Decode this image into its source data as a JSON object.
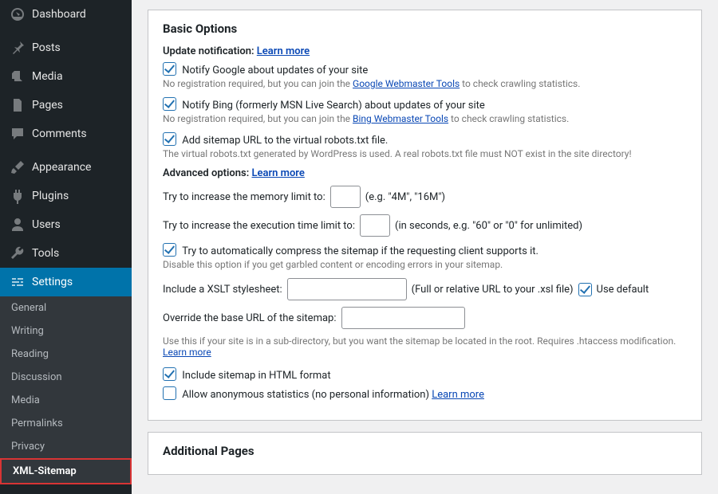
{
  "sidebar": {
    "items": [
      {
        "label": "Dashboard",
        "icon": "dashboard"
      },
      {
        "label": "Posts",
        "icon": "pin"
      },
      {
        "label": "Media",
        "icon": "media"
      },
      {
        "label": "Pages",
        "icon": "page"
      },
      {
        "label": "Comments",
        "icon": "comment"
      },
      {
        "label": "Appearance",
        "icon": "brush"
      },
      {
        "label": "Plugins",
        "icon": "plug"
      },
      {
        "label": "Users",
        "icon": "user"
      },
      {
        "label": "Tools",
        "icon": "wrench"
      },
      {
        "label": "Settings",
        "icon": "sliders",
        "current": true
      }
    ],
    "submenu": [
      {
        "label": "General"
      },
      {
        "label": "Writing"
      },
      {
        "label": "Reading"
      },
      {
        "label": "Discussion"
      },
      {
        "label": "Media"
      },
      {
        "label": "Permalinks"
      },
      {
        "label": "Privacy"
      },
      {
        "label": "XML-Sitemap",
        "active": true
      }
    ]
  },
  "panel": {
    "heading": "Basic Options",
    "update": {
      "label": "Update notification:",
      "learn_more": "Learn more",
      "google_label": "Notify Google about updates of your site",
      "google_help_pre": "No registration required, but you can join the ",
      "google_help_link": "Google Webmaster Tools",
      "google_help_post": " to check crawling statistics.",
      "bing_label": "Notify Bing (formerly MSN Live Search) about updates of your site",
      "bing_help_pre": "No registration required, but you can join the ",
      "bing_help_link": "Bing Webmaster Tools",
      "bing_help_post": " to check crawling statistics.",
      "robots_label": "Add sitemap URL to the virtual robots.txt file.",
      "robots_help": "The virtual robots.txt generated by WordPress is used. A real robots.txt file must NOT exist in the site directory!"
    },
    "advanced": {
      "label": "Advanced options:",
      "learn_more": "Learn more",
      "memory_pre": "Try to increase the memory limit to:",
      "memory_hint": "(e.g. \"4M\", \"16M\")",
      "time_pre": "Try to increase the execution time limit to:",
      "time_hint": "(in seconds, e.g. \"60\" or \"0\" for unlimited)",
      "compress_label": "Try to automatically compress the sitemap if the requesting client supports it.",
      "compress_help": "Disable this option if you get garbled content or encoding errors in your sitemap.",
      "xslt_pre": "Include a XSLT stylesheet:",
      "xslt_hint": "(Full or relative URL to your .xsl file)",
      "xslt_default_label": "Use default",
      "baseurl_pre": "Override the base URL of the sitemap:",
      "baseurl_help_pre": "Use this if your site is in a sub-directory, but you want the sitemap be located in the root. Requires .htaccess modification. ",
      "baseurl_help_link": "Learn more",
      "include_html_label": "Include sitemap in HTML format",
      "anon_stats_label": "Allow anonymous statistics (no personal information) ",
      "anon_stats_link": "Learn more"
    }
  },
  "additional": {
    "heading": "Additional Pages"
  },
  "checked": {
    "google": true,
    "bing": true,
    "robots": true,
    "compress": true,
    "xslt_default": true,
    "include_html": true,
    "anon_stats": false
  }
}
